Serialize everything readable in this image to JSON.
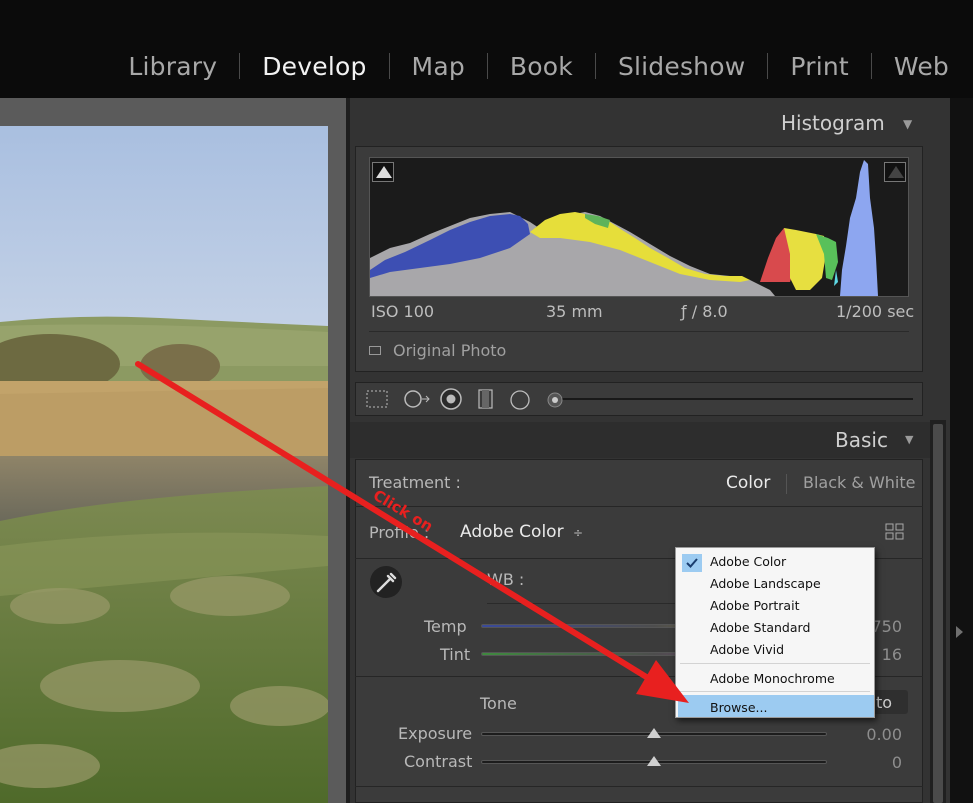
{
  "modules": {
    "library": "Library",
    "develop": "Develop",
    "map": "Map",
    "book": "Book",
    "slideshow": "Slideshow",
    "print": "Print",
    "web": "Web",
    "active": "Develop"
  },
  "histogram": {
    "title": "Histogram",
    "iso": "ISO 100",
    "focal": "35 mm",
    "aperture": "ƒ / 8.0",
    "shutter": "1/200 sec",
    "original_photo": "Original Photo"
  },
  "basic": {
    "title": "Basic",
    "treatment_label": "Treatment :",
    "treatment_color": "Color",
    "treatment_bw": "Black & White",
    "profile_label": "Profile :",
    "profile_value": "Adobe Color",
    "profile_caret": "÷",
    "wb_label": "WB :",
    "temp_label": "Temp",
    "temp_value": "750",
    "tint_label": "Tint",
    "tint_value": "16",
    "tone_label": "Tone",
    "auto_label": "to",
    "exposure_label": "Exposure",
    "exposure_value": "0.00",
    "contrast_label": "Contrast",
    "contrast_value": "0"
  },
  "sliders": {
    "temp": 0.68,
    "tint": 0.9,
    "exposure": 0.5,
    "contrast": 0.5
  },
  "profile_menu": {
    "items": [
      "Adobe Color",
      "Adobe Landscape",
      "Adobe Portrait",
      "Adobe Standard",
      "Adobe Vivid",
      "Adobe Monochrome",
      "Browse..."
    ],
    "checked": "Adobe Color",
    "highlighted": "Browse..."
  },
  "annotation": {
    "text": "Click on",
    "color": "#e8201f"
  },
  "colors": {
    "accent_highlight": "#9ccbf1",
    "panel_bg": "#3b3b3b",
    "active_module": "#f2f2f2"
  }
}
